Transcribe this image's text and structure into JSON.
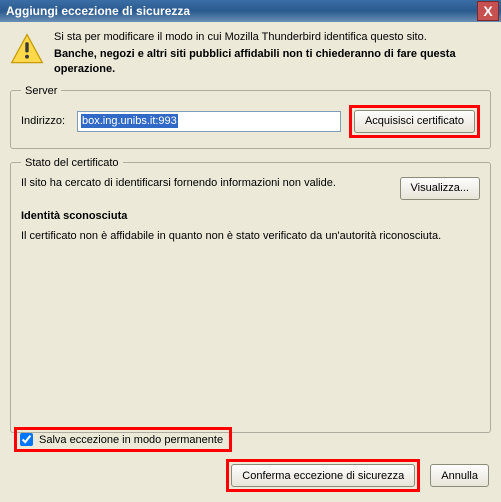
{
  "title": "Aggiungi eccezione di sicurezza",
  "intro": {
    "line1": "Si sta per modificare il modo in cui Mozilla Thunderbird identifica questo sito.",
    "line2": "Banche, negozi e altri siti pubblici affidabili non ti chiederanno di fare questa operazione."
  },
  "server": {
    "legend": "Server",
    "address_label": "Indirizzo:",
    "address_value": "box.ing.unibs.it:993",
    "get_cert_button": "Acquisisci certificato"
  },
  "cert": {
    "legend": "Stato del certificato",
    "desc": "Il sito ha cercato di identificarsi fornendo informazioni non valide.",
    "view_button": "Visualizza...",
    "identity_title": "Identità sconosciuta",
    "identity_desc": "Il certificato non è affidabile in quanto non è stato verificato da un'autorità riconosciuta."
  },
  "permanent": {
    "label": "Salva eccezione in modo permanente",
    "checked": true
  },
  "footer": {
    "confirm": "Conferma eccezione di sicurezza",
    "cancel": "Annulla"
  },
  "icons": {
    "close": "X"
  }
}
